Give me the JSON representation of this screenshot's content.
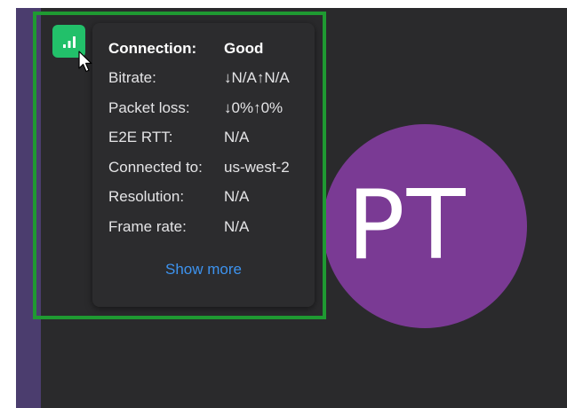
{
  "avatar": {
    "initials": "PT",
    "color": "#7a3a94"
  },
  "signal_button": {
    "icon": "signal-bars-icon",
    "color": "#22c06a"
  },
  "stats": {
    "connection": {
      "label": "Connection:",
      "value": "Good"
    },
    "bitrate": {
      "label": "Bitrate:",
      "value": "↓N/A↑N/A"
    },
    "packet_loss": {
      "label": "Packet loss:",
      "value": "↓0%↑0%"
    },
    "e2e_rtt": {
      "label": "E2E RTT:",
      "value": "N/A"
    },
    "connected_to": {
      "label": "Connected to:",
      "value": "us-west-2"
    },
    "resolution": {
      "label": "Resolution:",
      "value": "N/A"
    },
    "frame_rate": {
      "label": "Frame rate:",
      "value": "N/A"
    }
  },
  "show_more": {
    "label": "Show more"
  },
  "colors": {
    "highlight": "#1f9a32",
    "link": "#3d93ef",
    "tooltip_bg": "#2c2c2e"
  }
}
